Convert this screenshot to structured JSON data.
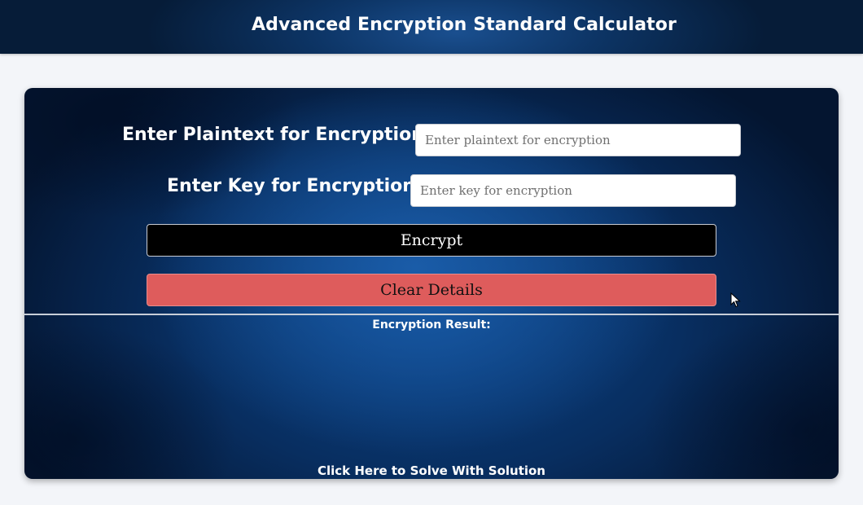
{
  "header": {
    "title": "Advanced Encryption Standard Calculator"
  },
  "form": {
    "plaintext_label": "Enter Plaintext for Encryption:",
    "plaintext_placeholder": "Enter plaintext for encryption",
    "plaintext_value": "",
    "key_label": "Enter Key for Encryption:",
    "key_placeholder": "Enter key for encryption",
    "key_value": "",
    "encrypt_label": "Encrypt",
    "clear_label": "Clear Details"
  },
  "result": {
    "label": "Encryption Result:",
    "value": ""
  },
  "footer": {
    "solve_link_label": "Click Here to Solve With Solution"
  },
  "colors": {
    "header_bg": "#0d3566",
    "card_bg": "#0c4488",
    "encrypt_button_bg": "#000000",
    "clear_button_bg": "#de5c5c",
    "page_bg": "#f3f5f9"
  },
  "icons": {
    "cursor": "mouse-pointer-icon"
  }
}
